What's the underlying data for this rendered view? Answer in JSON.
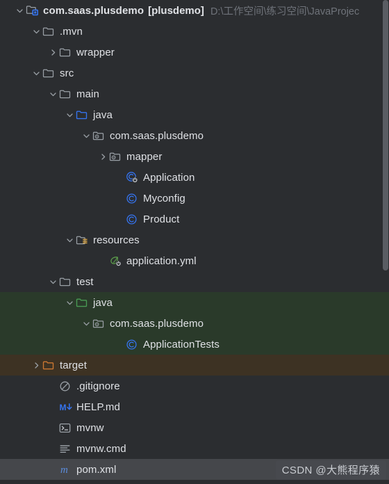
{
  "theme": {
    "background": "#2b2d30",
    "text": "#dfe1e5",
    "muted_text": "#6f737a",
    "selection": "#45474b",
    "highlight_green": "#2a3a2a",
    "highlight_brown": "#3d3223",
    "folder_gray": "#9aa0a6",
    "folder_blue": "#3574f0",
    "folder_green": "#499c54",
    "folder_orange": "#cc7832",
    "class_blue": "#3574f0",
    "spring_green": "#6a8759",
    "maven_blue": "#5b8cdb",
    "scrollbar": "#5a5d63"
  },
  "panel": {
    "name": "project-tool-window"
  },
  "watermark": {
    "text": "CSDN @大熊程序猿"
  },
  "tree": {
    "items": [
      {
        "id": "root",
        "depth": 0,
        "label": "com.saas.plusdemo",
        "module": "[plusdemo]",
        "path": "D:\\工作空间\\练习空间\\JavaProjec",
        "icon": "module-folder-icon",
        "chevron": "expanded",
        "bold": true,
        "highlight": "none"
      },
      {
        "id": "mvn",
        "depth": 1,
        "label": ".mvn",
        "icon": "folder-icon",
        "chevron": "expanded",
        "highlight": "none"
      },
      {
        "id": "wrapper",
        "depth": 2,
        "label": "wrapper",
        "icon": "folder-icon",
        "chevron": "collapsed",
        "highlight": "none"
      },
      {
        "id": "src",
        "depth": 1,
        "label": "src",
        "icon": "folder-icon",
        "chevron": "expanded",
        "highlight": "none"
      },
      {
        "id": "main",
        "depth": 2,
        "label": "main",
        "icon": "folder-icon",
        "chevron": "expanded",
        "highlight": "none"
      },
      {
        "id": "main-java",
        "depth": 3,
        "label": "java",
        "icon": "source-folder-blue-icon",
        "chevron": "expanded",
        "highlight": "none"
      },
      {
        "id": "main-package",
        "depth": 4,
        "label": "com.saas.plusdemo",
        "icon": "package-folder-icon",
        "chevron": "expanded",
        "highlight": "none"
      },
      {
        "id": "mapper",
        "depth": 5,
        "label": "mapper",
        "icon": "package-folder-icon",
        "chevron": "collapsed",
        "highlight": "none"
      },
      {
        "id": "application-class",
        "depth": 6,
        "label": "Application",
        "icon": "runnable-class-icon",
        "chevron": "none",
        "highlight": "none"
      },
      {
        "id": "myconfig-class",
        "depth": 6,
        "label": "Myconfig",
        "icon": "class-icon",
        "chevron": "none",
        "highlight": "none"
      },
      {
        "id": "product-class",
        "depth": 6,
        "label": "Product",
        "icon": "class-icon",
        "chevron": "none",
        "highlight": "none"
      },
      {
        "id": "resources",
        "depth": 3,
        "label": "resources",
        "icon": "resources-folder-icon",
        "chevron": "expanded",
        "highlight": "none"
      },
      {
        "id": "application-yml",
        "depth": 5,
        "label": "application.yml",
        "icon": "spring-config-icon",
        "chevron": "none",
        "highlight": "none"
      },
      {
        "id": "test",
        "depth": 2,
        "label": "test",
        "icon": "folder-icon",
        "chevron": "expanded",
        "highlight": "none"
      },
      {
        "id": "test-java",
        "depth": 3,
        "label": "java",
        "icon": "test-source-folder-green-icon",
        "chevron": "expanded",
        "highlight": "green"
      },
      {
        "id": "test-package",
        "depth": 4,
        "label": "com.saas.plusdemo",
        "icon": "package-folder-icon",
        "chevron": "expanded",
        "highlight": "green"
      },
      {
        "id": "application-tests",
        "depth": 6,
        "label": "ApplicationTests",
        "icon": "class-icon",
        "chevron": "none",
        "highlight": "green"
      },
      {
        "id": "target",
        "depth": 1,
        "label": "target",
        "icon": "excluded-folder-icon",
        "chevron": "collapsed",
        "highlight": "brown"
      },
      {
        "id": "gitignore",
        "depth": 2,
        "label": ".gitignore",
        "icon": "ignored-file-icon",
        "chevron": "none",
        "highlight": "none"
      },
      {
        "id": "help-md",
        "depth": 2,
        "label": "HELP.md",
        "icon": "markdown-icon",
        "chevron": "none",
        "highlight": "none"
      },
      {
        "id": "mvnw",
        "depth": 2,
        "label": "mvnw",
        "icon": "shell-script-icon",
        "chevron": "none",
        "highlight": "none"
      },
      {
        "id": "mvnw-cmd",
        "depth": 2,
        "label": "mvnw.cmd",
        "icon": "text-file-icon",
        "chevron": "none",
        "highlight": "none"
      },
      {
        "id": "pom-xml",
        "depth": 2,
        "label": "pom.xml",
        "icon": "maven-icon",
        "chevron": "none",
        "highlight": "selected"
      }
    ]
  }
}
